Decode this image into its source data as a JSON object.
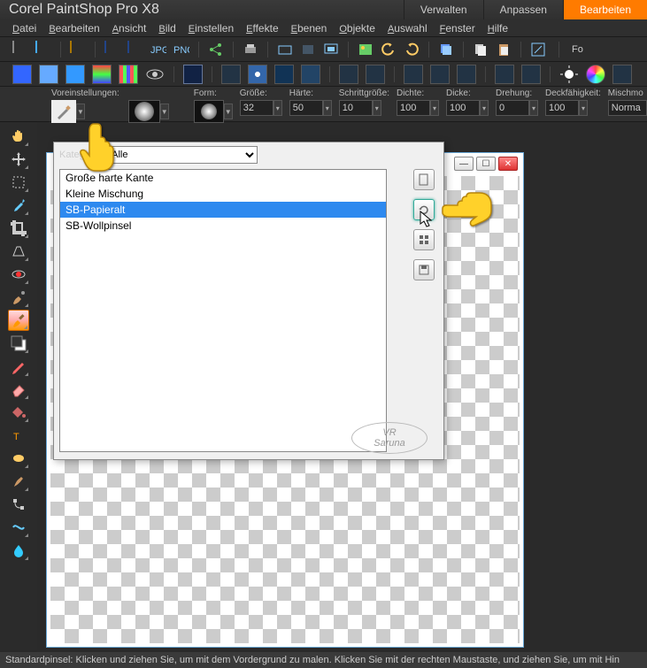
{
  "titlebar": {
    "title": "Corel PaintShop Pro X8",
    "tabs": {
      "verwalten": "Verwalten",
      "anpassen": "Anpassen",
      "bearbeiten": "Bearbeiten"
    }
  },
  "menu": {
    "datei": "Datei",
    "bearbeiten": "Bearbeiten",
    "ansicht": "Ansicht",
    "bild": "Bild",
    "einstellen": "Einstellen",
    "effekte": "Effekte",
    "ebenen": "Ebenen",
    "objekte": "Objekte",
    "auswahl": "Auswahl",
    "fenster": "Fenster",
    "hilfe": "Hilfe"
  },
  "options": {
    "voreinstellungen_label": "Voreinstellungen:",
    "form_label": "Form:",
    "groesse": {
      "label": "Größe:",
      "value": "32"
    },
    "haerte": {
      "label": "Härte:",
      "value": "50"
    },
    "schritt": {
      "label": "Schrittgröße:",
      "value": "10"
    },
    "dichte": {
      "label": "Dichte:",
      "value": "100"
    },
    "dicke": {
      "label": "Dicke:",
      "value": "100"
    },
    "drehung": {
      "label": "Drehung:",
      "value": "0"
    },
    "deck": {
      "label": "Deckfähigkeit:",
      "value": "100"
    },
    "misch": {
      "label": "Mischmo",
      "value": "Norma"
    }
  },
  "popup": {
    "kategorie_label": "Kategorie:",
    "kategorie_value": "Alle",
    "btn_icons": [
      "file-icon",
      "refresh-icon",
      "grid-icon",
      "save-icon"
    ],
    "items": [
      {
        "label": "Große harte Kante",
        "sel": false
      },
      {
        "label": "Kleine Mischung",
        "sel": false
      },
      {
        "label": "SB-Papieralt",
        "sel": true
      },
      {
        "label": "SB-Wollpinsel",
        "sel": false
      }
    ],
    "watermark": {
      "l1": "VR",
      "l2": "Saruna"
    }
  },
  "toolbar2_text": "Fo",
  "statusbar": "Standardpinsel: Klicken und ziehen Sie, um mit dem Vordergrund zu malen. Klicken Sie mit der rechten Maustaste, und ziehen Sie, um mit Hin"
}
